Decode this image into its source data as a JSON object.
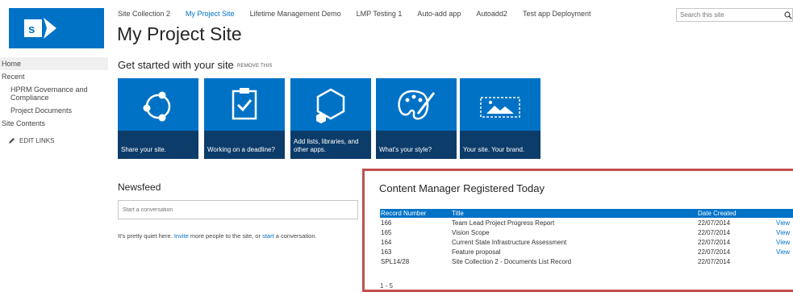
{
  "topnav": {
    "items": [
      "Site Collection 2",
      "My Project Site",
      "Lifetime Management Demo",
      "LMP Testing 1",
      "Auto-add app",
      "Autoadd2",
      "Test app Deployment"
    ],
    "active_index": 1
  },
  "site_title": "My Project Site",
  "search": {
    "placeholder": "Search this site"
  },
  "leftnav": {
    "home": "Home",
    "recent": "Recent",
    "recent_items": [
      "HPRM Governance and Compliance",
      "Project Documents"
    ],
    "site_contents": "Site Contents",
    "edit_links": "EDIT LINKS"
  },
  "getting_started": {
    "title": "Get started with your site",
    "remove": "REMOVE THIS",
    "tiles": [
      {
        "label": "Share your site.",
        "icon": "share-icon"
      },
      {
        "label": "Working on a deadline?",
        "icon": "clipboard-check-icon"
      },
      {
        "label": "Add lists, libraries, and other apps.",
        "icon": "hexagon-apps-icon"
      },
      {
        "label": "What's your style?",
        "icon": "palette-icon"
      },
      {
        "label": "Your site. Your brand.",
        "icon": "image-brand-icon"
      }
    ]
  },
  "newsfeed": {
    "title": "Newsfeed",
    "placeholder": "Start a conversation",
    "text_before": "It's pretty quiet here. ",
    "invite_link": "Invite",
    "text_middle": " more people to the site, or ",
    "start_link": "start",
    "text_after": " a conversation."
  },
  "content_manager": {
    "title": "Content Manager Registered Today",
    "columns": [
      "Record Number",
      "Title",
      "Date Created"
    ],
    "rows": [
      {
        "record": "166",
        "title": "Team Lead Project Progress Report",
        "date": "22/07/2014",
        "action": "View"
      },
      {
        "record": "165",
        "title": "Vision Scope",
        "date": "22/07/2014",
        "action": "View"
      },
      {
        "record": "164",
        "title": "Current State Infrastructure Assessment",
        "date": "22/07/2014",
        "action": "View"
      },
      {
        "record": "163",
        "title": "Feature proposal",
        "date": "22/07/2014",
        "action": "View"
      },
      {
        "record": "SPL14/28",
        "title": "Site Collection 2 - Documents List Record",
        "date": "22/07/2014",
        "action": ""
      }
    ],
    "pagination": "1 - 5"
  },
  "colors": {
    "accent": "#0072c6",
    "tile_band": "#0c3c6a",
    "highlight_frame": "#c0504d"
  }
}
